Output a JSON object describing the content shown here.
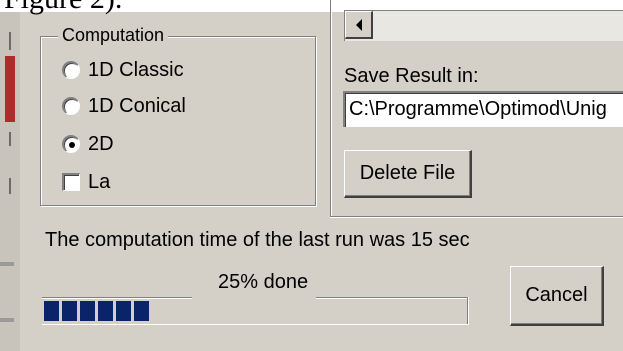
{
  "document": {
    "cropped_heading": "Figure 2)."
  },
  "computation_group": {
    "legend": "Computation",
    "options": [
      {
        "label": "1D Classic",
        "selected": false
      },
      {
        "label": "1D Conical",
        "selected": false
      },
      {
        "label": "2D",
        "selected": true
      }
    ],
    "checkbox": {
      "label": "La",
      "checked": false
    }
  },
  "save": {
    "label": "Save Result in:",
    "path": "C:\\Programme\\Optimod\\Unig"
  },
  "delete_button_label": "Delete File",
  "status_text": "The computation time of the last run was 15 sec",
  "progress": {
    "label": "25% done",
    "percent": 25,
    "blocks": 6
  },
  "cancel_button_label": "Cancel",
  "colors": {
    "face": "#d4d0c8",
    "progress_fill": "#0a246a",
    "field_bg": "#ffffff"
  }
}
